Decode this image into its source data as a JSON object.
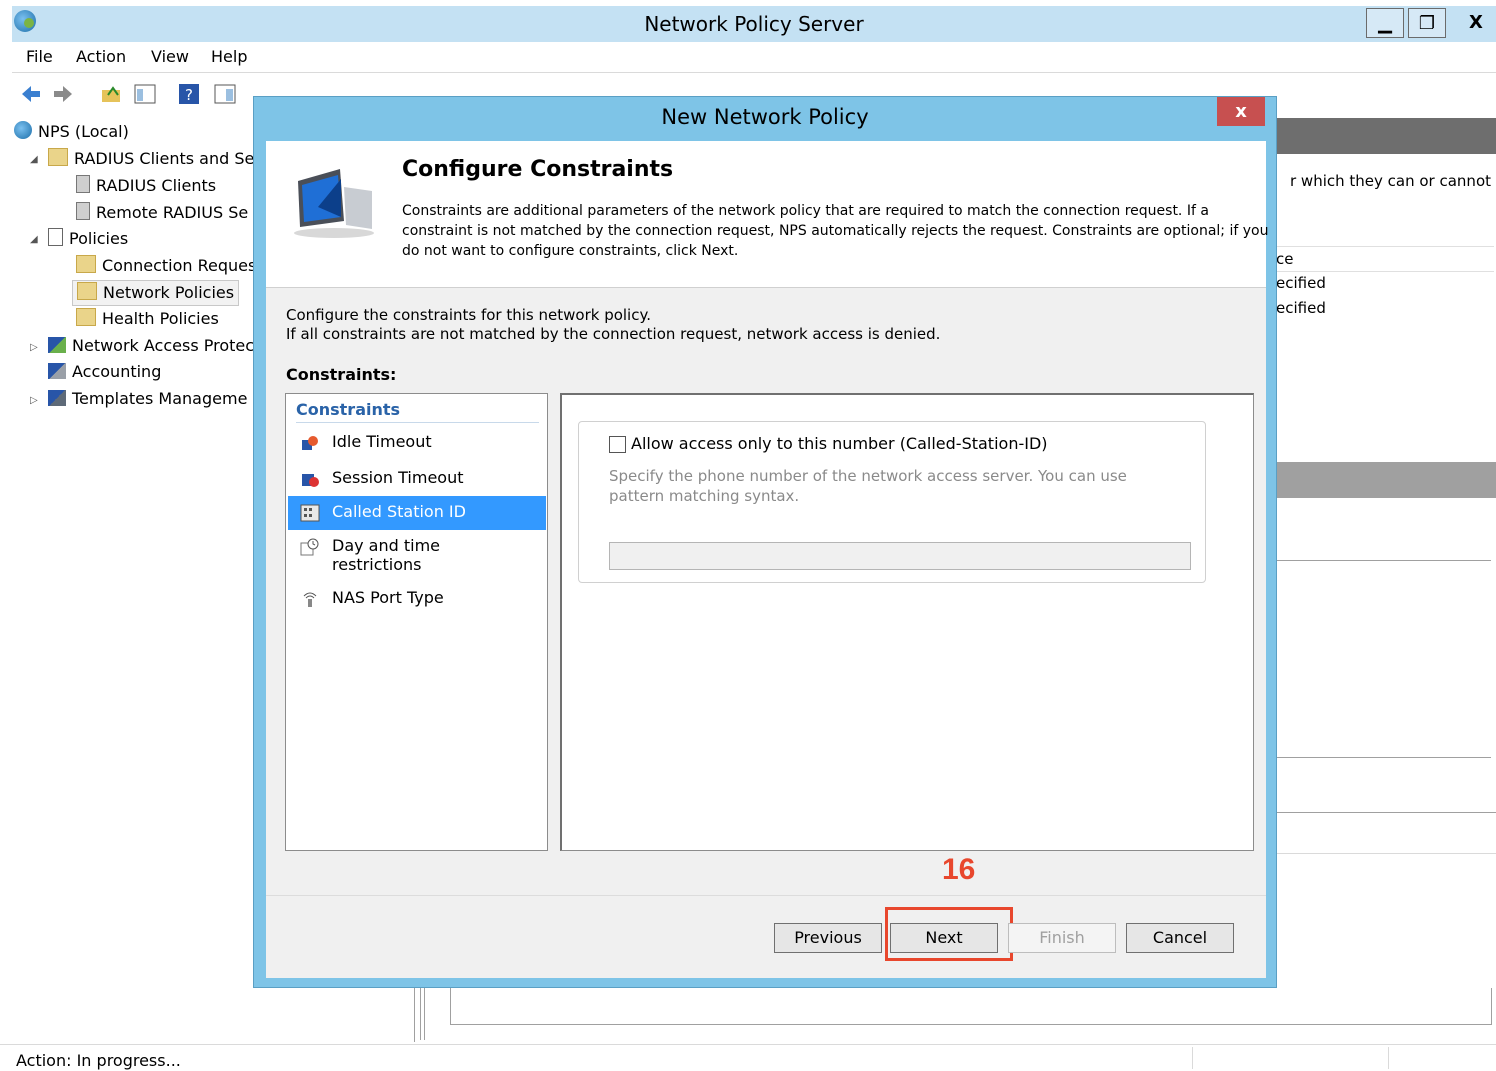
{
  "window": {
    "title": "Network Policy Server",
    "controls": {
      "minimize": "▁",
      "maximize": "❐",
      "close": "X"
    }
  },
  "menubar": [
    "File",
    "Action",
    "View",
    "Help"
  ],
  "tree": {
    "root": "NPS (Local)",
    "radius_group": "RADIUS Clients and Ser",
    "radius_clients": "RADIUS Clients",
    "remote_radius": "Remote RADIUS Se",
    "policies": "Policies",
    "connection_request": "Connection Reques",
    "network_policies": "Network Policies",
    "health_policies": "Health Policies",
    "nap": "Network Access Protec",
    "accounting": "Accounting",
    "templates": "Templates Manageme"
  },
  "background_pane": {
    "desc_fragment": "r which they can or cannot",
    "col_fragment": "ce",
    "row1": "ecified",
    "row2": "ecified"
  },
  "status": "Action:  In progress...",
  "dialog": {
    "title": "New Network Policy",
    "close": "x",
    "header_title": "Configure Constraints",
    "header_desc": "Constraints are additional parameters of the network policy that are required to match the connection request. If a constraint is not matched by the connection request, NPS automatically rejects the request. Constraints are optional; if you do not want to configure constraints, click Next.",
    "intro_line1": "Configure the constraints for this network policy.",
    "intro_line2": "If all constraints are not matched by the connection request, network access is denied.",
    "constraints_label": "Constraints:",
    "list_header": "Constraints",
    "list_items": [
      {
        "label": "Idle Timeout",
        "selected": false
      },
      {
        "label": "Session Timeout",
        "selected": false
      },
      {
        "label": "Called Station ID",
        "selected": true
      },
      {
        "label": "Day and time restrictions",
        "selected": false
      },
      {
        "label": "NAS Port Type",
        "selected": false
      }
    ],
    "checkbox_label": "Allow access only to this number (Called-Station-ID)",
    "checkbox_checked": false,
    "spec_text": "Specify the phone number of the network access server. You can use pattern matching syntax.",
    "phone_value": "",
    "buttons": {
      "previous": "Previous",
      "next": "Next",
      "finish": "Finish",
      "cancel": "Cancel"
    },
    "step_annotation": "16"
  },
  "colors": {
    "dialog_frame": "#7ec4e7",
    "title_bar": "#c4e1f3",
    "selection": "#3399ff",
    "annotation": "#e8472d",
    "close_button": "#c75050"
  }
}
